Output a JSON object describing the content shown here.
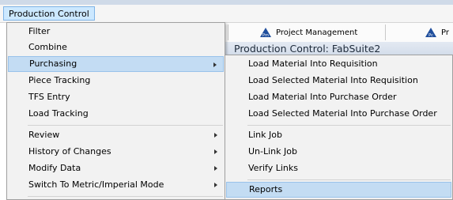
{
  "menubar": {
    "active_menu": "Production Control"
  },
  "background": {
    "toolbar": {
      "buttons": [
        {
          "label": "Project Management",
          "icon": "pm-triangle-icon"
        },
        {
          "label": "Pr",
          "icon": "pc-triangle-icon"
        }
      ]
    },
    "panel_title": "Production Control: FabSuite2"
  },
  "main_menu": {
    "items": [
      {
        "label": "Filter"
      },
      {
        "label": "Combine"
      },
      {
        "label": "Purchasing",
        "submenu": true,
        "highlighted": true
      },
      {
        "label": "Piece Tracking"
      },
      {
        "label": "TFS Entry"
      },
      {
        "label": "Load Tracking"
      },
      {
        "label": "Review",
        "submenu": true
      },
      {
        "label": "History of Changes",
        "submenu": true
      },
      {
        "label": "Modify Data",
        "submenu": true
      },
      {
        "label": "Switch To Metric/Imperial Mode",
        "submenu": true
      }
    ]
  },
  "purchasing_submenu": {
    "items": [
      {
        "label": "Load Material Into Requisition"
      },
      {
        "label": "Load Selected Material Into Requisition"
      },
      {
        "label": "Load Material Into Purchase Order"
      },
      {
        "label": "Load Selected Material Into Purchase Order"
      },
      {
        "label": "Link Job"
      },
      {
        "label": "Un-Link Job"
      },
      {
        "label": "Verify Links"
      },
      {
        "label": "Reports",
        "highlighted": true
      }
    ]
  },
  "colors": {
    "highlight": "#c3dcf3",
    "menu_background": "#f2f2f2",
    "toolbar_icon": "#1f4e9c"
  }
}
